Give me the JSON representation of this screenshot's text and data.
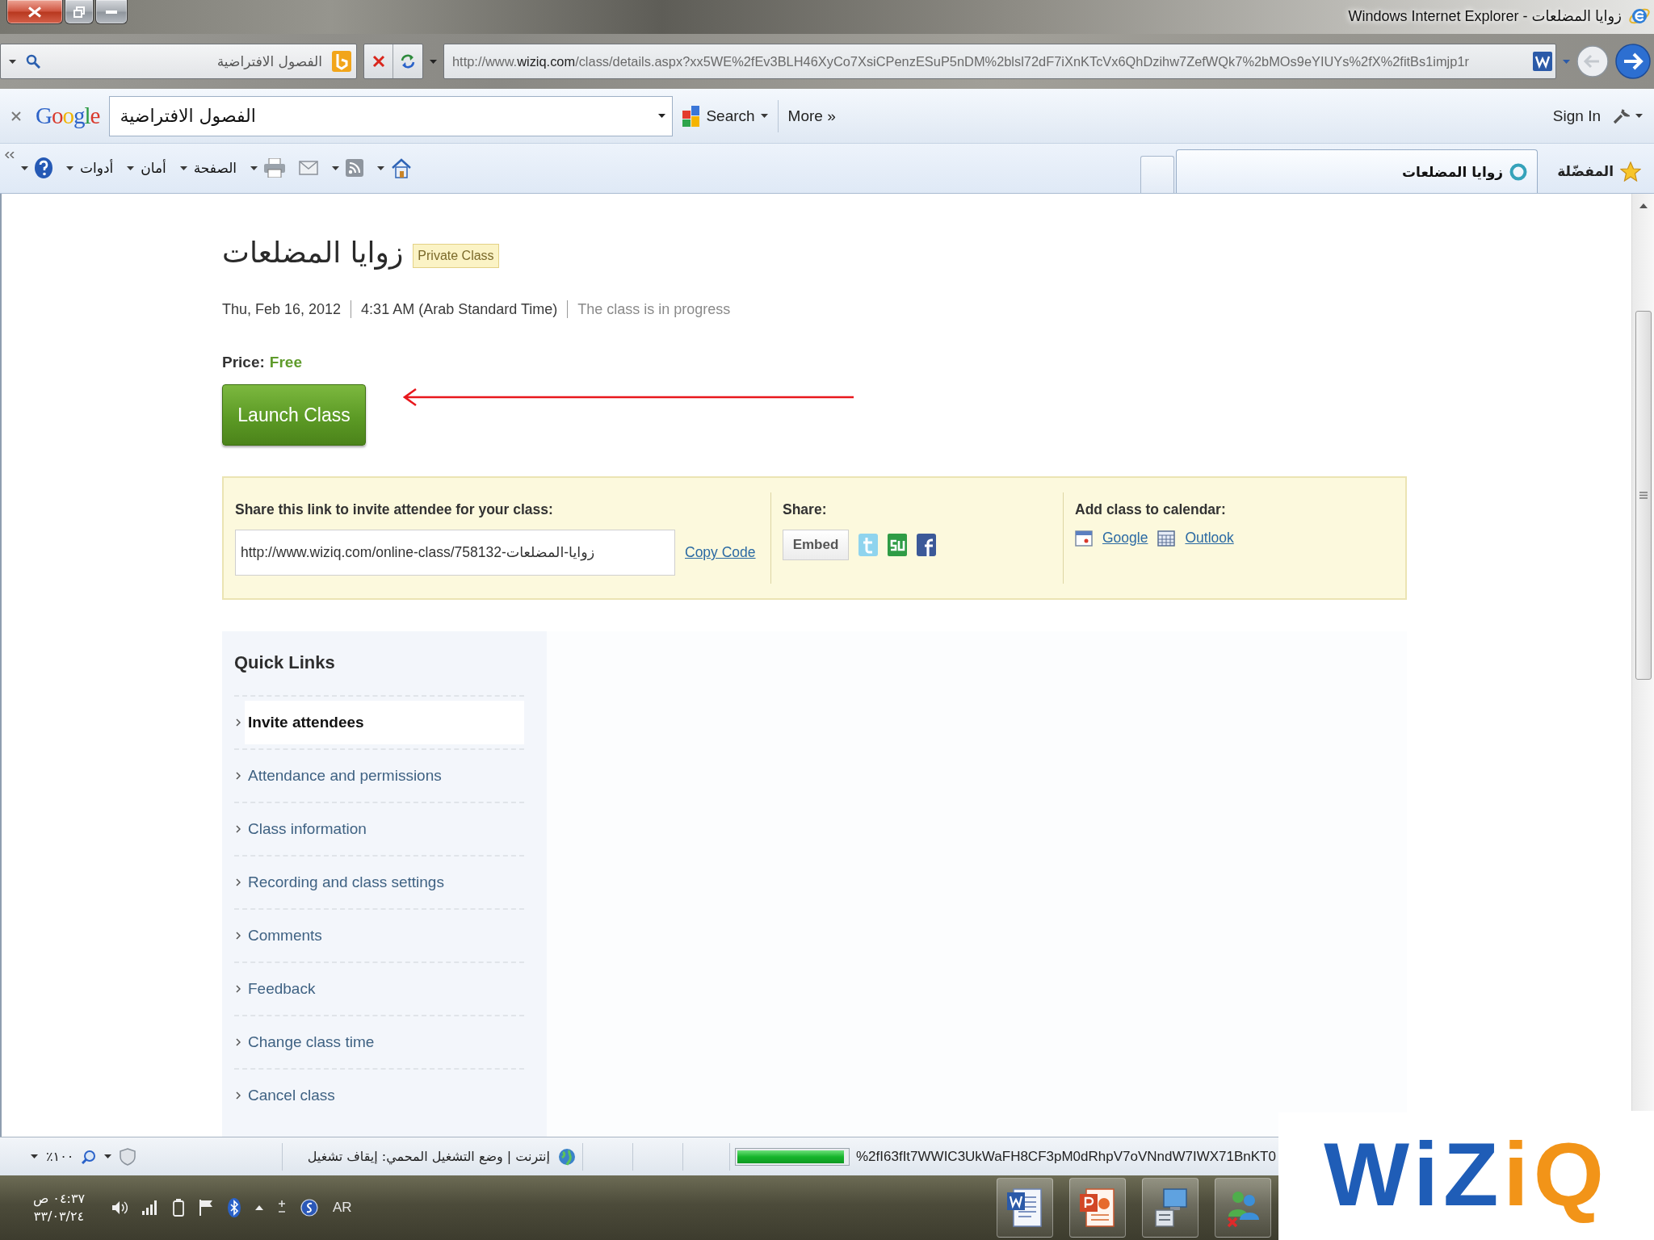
{
  "window": {
    "title": "زوايا المضلعات - Windows Internet Explorer"
  },
  "address_bar": {
    "search": {
      "value": "الفصول الافتراضية"
    },
    "url": "http://www.**wiziq.com**/class/details.aspx?xx5WE%2fEv3BLH46XyCo7XsiCPenzESuP5nDM%2blsl72dF7iXnKTcVx6QhDzihw7ZefWQk7%2bMOs9eYIUYs%2fX%2fitBs1imjp1r"
  },
  "google_toolbar": {
    "logo": "Google",
    "query": "الفصول الافتراضية",
    "search_button": "Search",
    "more_button": "More »",
    "sign_in": "Sign In"
  },
  "command_bar": {
    "menus": [
      "الصفحة",
      "أمان",
      "أدوات"
    ],
    "tabs": [
      {
        "label": "زوايا المضلعات",
        "selected": true
      }
    ],
    "favorites": "المفضّلة"
  },
  "page": {
    "title": "زوايا المضلعات",
    "badge": "Private Class",
    "schedule": {
      "date": "Thu, Feb 16, 2012",
      "time": "4:31 AM (Arab Standard Time)",
      "status": "The class is in progress"
    },
    "price": {
      "label": "Price:",
      "value": "Free"
    },
    "launch_button": "Launch Class",
    "share_panel": {
      "invite": {
        "heading": "Share this link to invite attendee for your class:",
        "link": "http://www.wiziq.com/online-class/758132-زوايا-المضلعات",
        "copy_link": "Copy Code"
      },
      "share": {
        "heading": "Share:",
        "embed_button": "Embed"
      },
      "calendar": {
        "heading": "Add class to calendar:",
        "google_link": "Google",
        "outlook_link": "Outlook"
      }
    },
    "quick_links": {
      "heading": "Quick Links",
      "items": [
        {
          "label": "Invite attendees",
          "selected": true
        },
        {
          "label": "Attendance and permissions",
          "selected": false
        },
        {
          "label": "Class information",
          "selected": false
        },
        {
          "label": "Recording and class settings",
          "selected": false
        },
        {
          "label": "Comments",
          "selected": false
        },
        {
          "label": "Feedback",
          "selected": false
        },
        {
          "label": "Change class time",
          "selected": false
        },
        {
          "label": "Cancel class",
          "selected": false
        }
      ]
    }
  },
  "status_bar": {
    "zoom": "١٠٠٪",
    "zone": "إنترنت | وضع التشغيل المحمي: إيقاف تشغيل",
    "progress": {
      "level": 0.97
    },
    "url": "%2fI63fIt7WWIC3UkWaFH8CF3pM0dRhpV7oVNndW7IWX71BnKT0"
  },
  "taskbar": {
    "clock": {
      "time": "٠٤:٣٧ ص",
      "date": "٣٣/٠٣/٢٤"
    },
    "language": "AR"
  },
  "logo": {
    "main": "WiZ",
    "accent": "iQ"
  }
}
